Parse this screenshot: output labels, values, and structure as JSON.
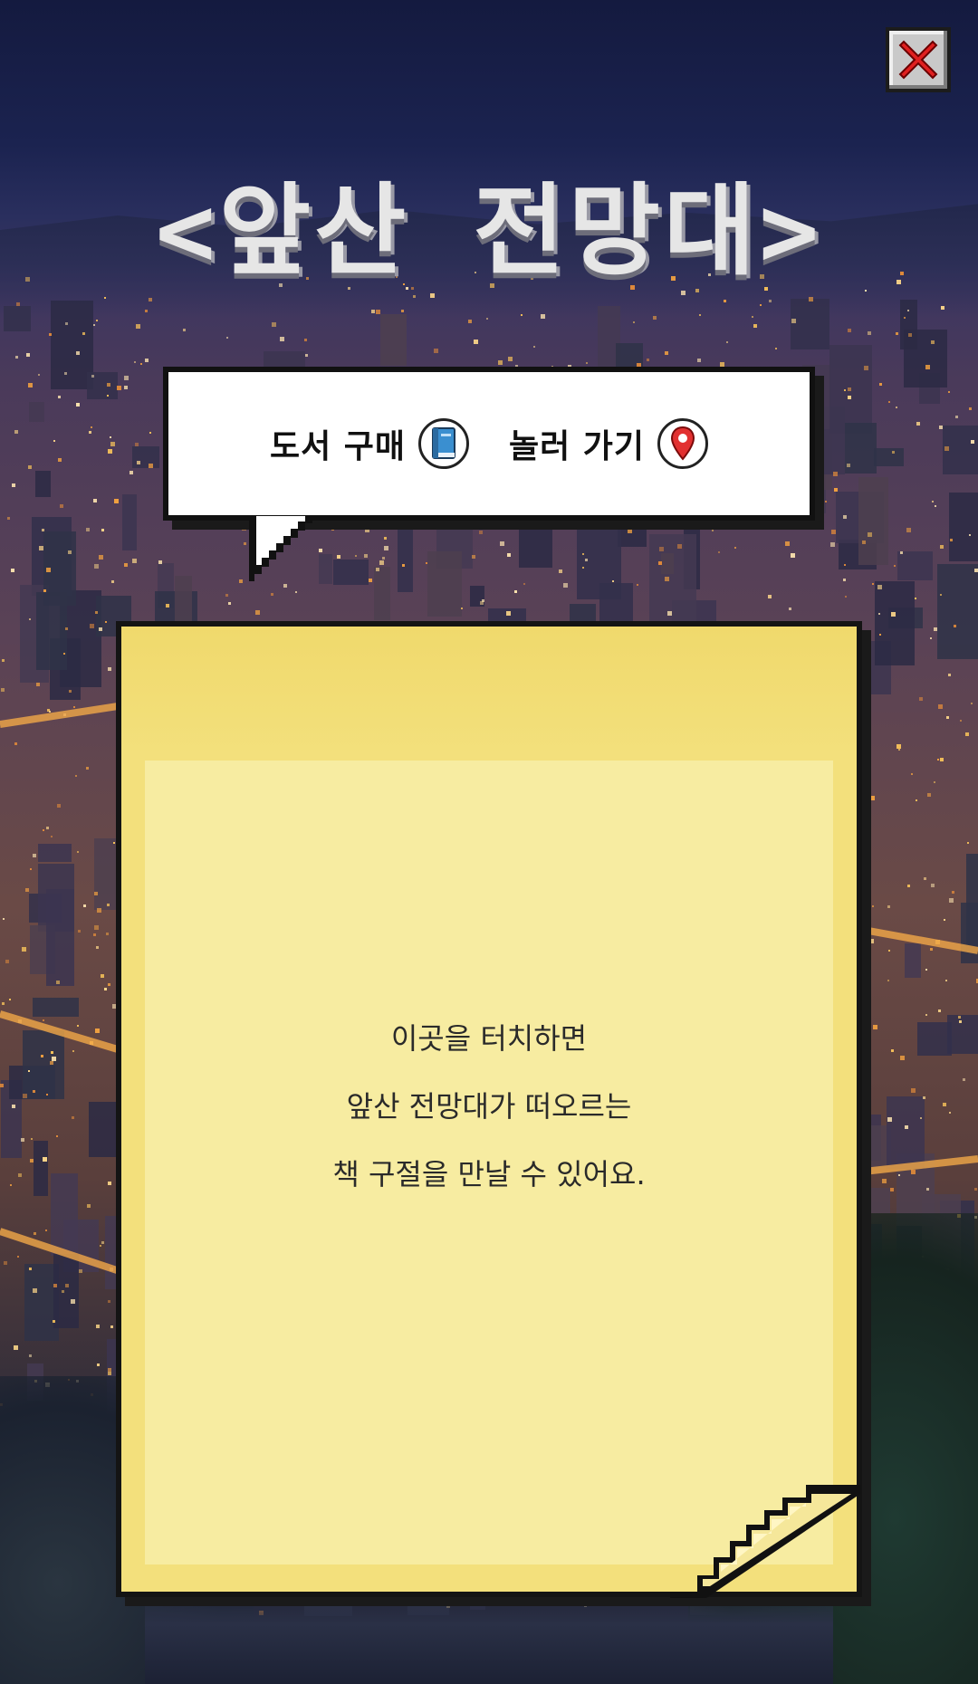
{
  "header": {
    "title": "<앞산 전망대>"
  },
  "close_button": {
    "icon": "close-icon",
    "color": "#e02020"
  },
  "bubble": {
    "links": [
      {
        "label": "도서 구매",
        "icon": "book-icon"
      },
      {
        "label": "놀러 가기",
        "icon": "map-pin-icon"
      }
    ]
  },
  "note": {
    "lines": [
      "이곳을 터치하면",
      "앞산 전망대가 떠오르는",
      "책 구절을 만날 수 있어요."
    ],
    "color": "#f3e07c"
  },
  "background": {
    "description_colors": [
      "#141a3f",
      "#6a4a46",
      "#f0b040"
    ]
  }
}
